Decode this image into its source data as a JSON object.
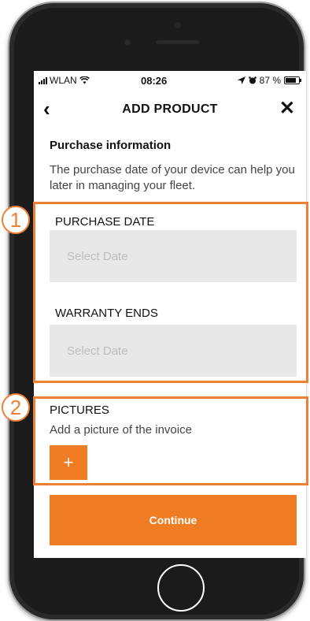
{
  "status_bar": {
    "carrier": "WLAN",
    "time": "08:26",
    "battery": "87 %",
    "wifi_icon": "wifi-icon",
    "location_icon": "location-arrow-icon",
    "alarm_icon": "alarm-icon"
  },
  "nav": {
    "back_icon": "‹",
    "title": "ADD PRODUCT",
    "close_icon": "✕"
  },
  "purchase": {
    "title": "Purchase information",
    "description": "The purchase date of your device can help you later in managing your fleet.",
    "purchase_date_label": "PURCHASE DATE",
    "purchase_date_placeholder": "Select Date",
    "warranty_label": "WARRANTY ENDS",
    "warranty_placeholder": "Select Date"
  },
  "pictures": {
    "title": "PICTURES",
    "description": "Add a picture of the invoice",
    "add_label": "+"
  },
  "continue_label": "Continue",
  "annotations": [
    "1",
    "2"
  ],
  "colors": {
    "accent": "#f07d23",
    "input_bg": "#e8e8e8",
    "annotation": "#ee8135"
  }
}
